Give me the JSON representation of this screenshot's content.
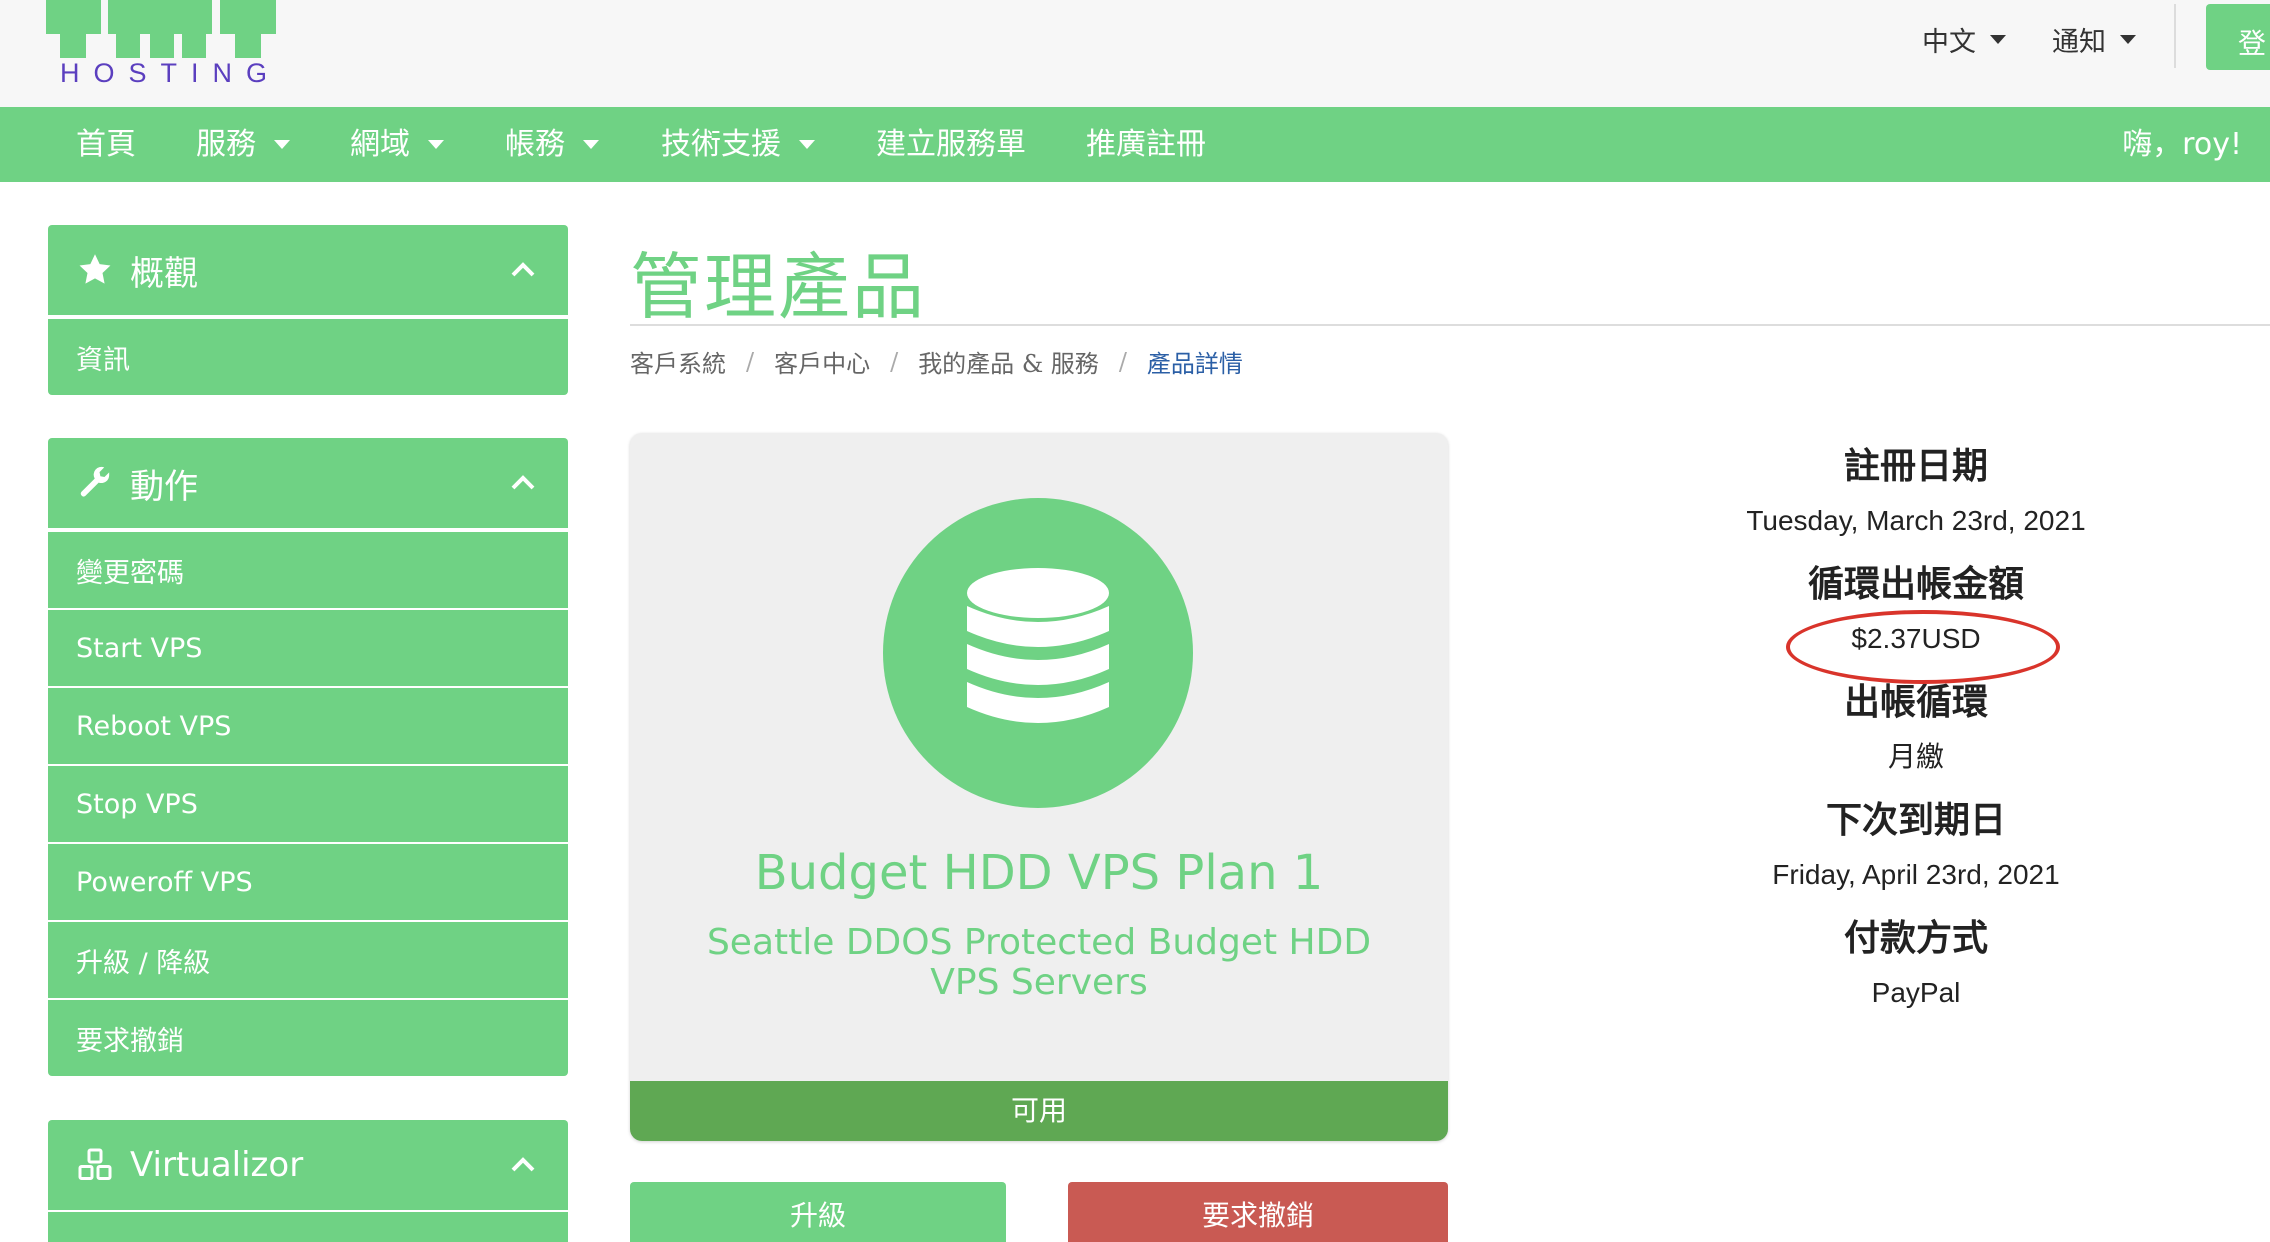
{
  "brand": {
    "logo_text": "HOSTING",
    "accent": "#6fd284",
    "logo_text_color": "#5b3fbf"
  },
  "top_bar": {
    "language": "中文",
    "notifications": "通知",
    "login": "登入"
  },
  "nav": {
    "items": [
      {
        "label": "首頁",
        "dropdown": false
      },
      {
        "label": "服務",
        "dropdown": true
      },
      {
        "label": "網域",
        "dropdown": true
      },
      {
        "label": "帳務",
        "dropdown": true
      },
      {
        "label": "技術支援",
        "dropdown": true
      },
      {
        "label": "建立服務單",
        "dropdown": false
      },
      {
        "label": "推廣註冊",
        "dropdown": false
      }
    ],
    "greeting": "嗨，roy!"
  },
  "sidebar": {
    "overview": {
      "title": "概觀",
      "icon": "star-icon",
      "items": [
        "資訊"
      ]
    },
    "actions": {
      "title": "動作",
      "icon": "wrench-icon",
      "items": [
        "變更密碼",
        "Start VPS",
        "Reboot VPS",
        "Stop VPS",
        "Poweroff VPS",
        "升級 / 降級",
        "要求撤銷"
      ]
    },
    "virtualizor": {
      "title": "Virtualizor",
      "icon": "cubes-icon"
    }
  },
  "page": {
    "title": "管理產品",
    "breadcrumb": [
      "客戶系統",
      "客戶中心",
      "我的產品 & 服務",
      "產品詳情"
    ]
  },
  "product": {
    "icon": "database-icon",
    "name": "Budget HDD VPS Plan 1",
    "description": "Seattle DDOS Protected Budget HDD VPS Servers",
    "status": "可用",
    "status_color": "#5fa853"
  },
  "buttons": {
    "upgrade": "升級",
    "cancel": "要求撤銷",
    "cancel_color": "#c95a53"
  },
  "details": {
    "registration_label": "註冊日期",
    "registration_date": "Tuesday, March 23rd, 2021",
    "recurring_label": "循環出帳金額",
    "recurring_amount": "$2.37USD",
    "billing_cycle_label": "出帳循環",
    "billing_cycle": "月繳",
    "next_due_label": "下次到期日",
    "next_due_date": "Friday, April 23rd, 2021",
    "payment_label": "付款方式",
    "payment_method": "PayPal",
    "highlight_color": "#d9342b"
  }
}
